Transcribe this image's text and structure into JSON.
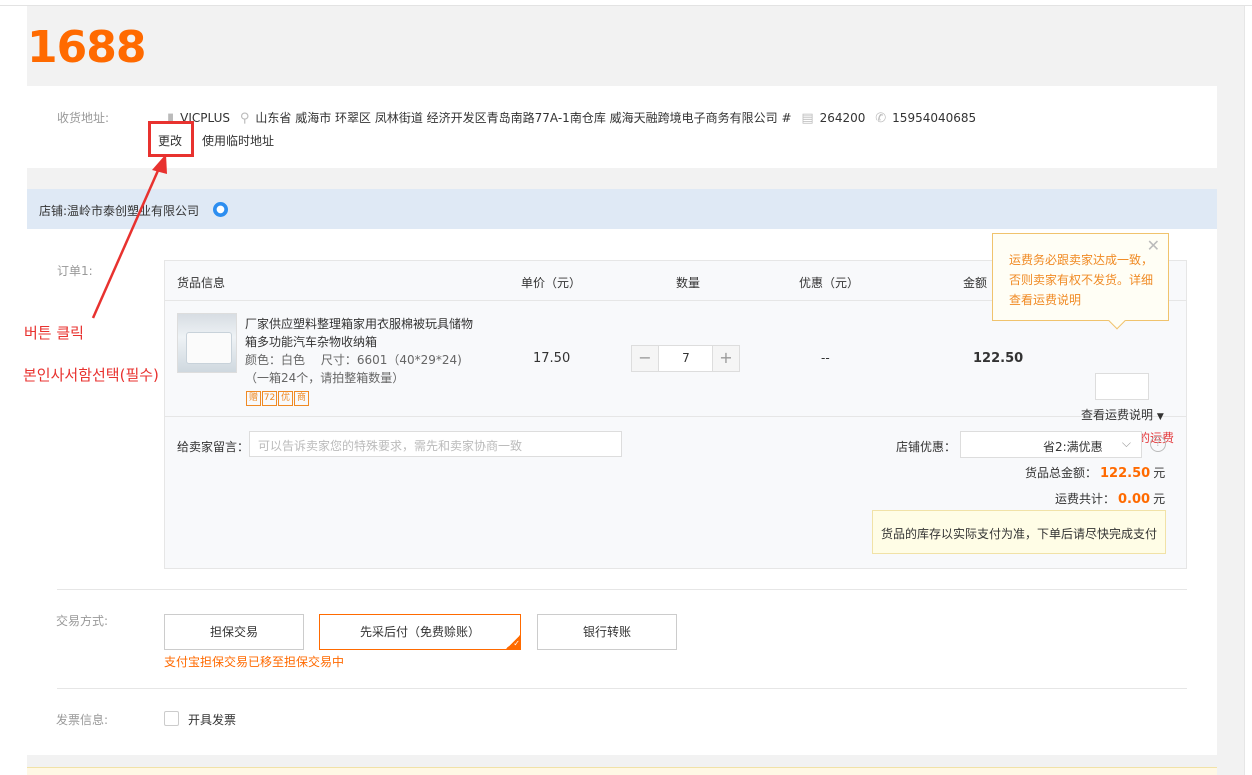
{
  "logo": "1688",
  "address": {
    "label": "收货地址:",
    "name": "VICPLUS",
    "full": "山东省 威海市 环翠区 凤林街道 经济开发区青岛南路77A-1南仓库 威海天融跨境电子商务有限公司 #",
    "zip": "264200",
    "phone": "15954040685",
    "change": "更改",
    "temp": "使用临时地址"
  },
  "shop": {
    "label": "店铺:",
    "name": "温岭市泰创塑业有限公司"
  },
  "order": {
    "label": "订单1:",
    "headers": {
      "info": "货品信息",
      "unit_price": "单价（元）",
      "quantity": "数量",
      "discount": "优惠（元）",
      "amount": "金额"
    },
    "item": {
      "name": "厂家供应塑料整理箱家用衣服棉被玩具储物箱多功能汽车杂物收纳箱",
      "attrs": "颜色：白色　 尺寸：6601（40*29*24)",
      "note": "（一箱24个，请拍整箱数量）",
      "tags": [
        "赠",
        "72",
        "优",
        "商"
      ],
      "price": "17.50",
      "quantity": "7",
      "discount": "--",
      "amount": "122.50"
    },
    "freight_link": "查看运费说明",
    "freight_warning": "请填写正确的运费",
    "tooltip": "运费务必跟卖家达成一致，否则卖家有权不发货。详细查看运费说明",
    "message_label": "给卖家留言：",
    "message_placeholder": "可以告诉卖家您的特殊要求，需先和卖家协商一致",
    "shop_discount_label": "店铺优惠：",
    "shop_discount_value": "省2:满优惠",
    "goods_total_label": "货品总金额：",
    "goods_total": "122.50",
    "freight_total_label": "运费共计：",
    "freight_total": "0.00",
    "currency": "元",
    "stock_notice": "货品的库存以实际支付为准，下单后请尽快完成支付"
  },
  "payment": {
    "label": "交易方式:",
    "options": [
      "担保交易",
      "先采后付（免费赊账）",
      "银行转账"
    ],
    "selected_index": 1,
    "note": "支付宝担保交易已移至担保交易中"
  },
  "invoice": {
    "label": "发票信息:",
    "option": "开具发票"
  },
  "annotations": {
    "line1": "버튼 클릭",
    "line2": "본인사서함선택(필수)"
  },
  "colors": {
    "brand": "#ff6a00",
    "annotation": "#e8322f"
  }
}
